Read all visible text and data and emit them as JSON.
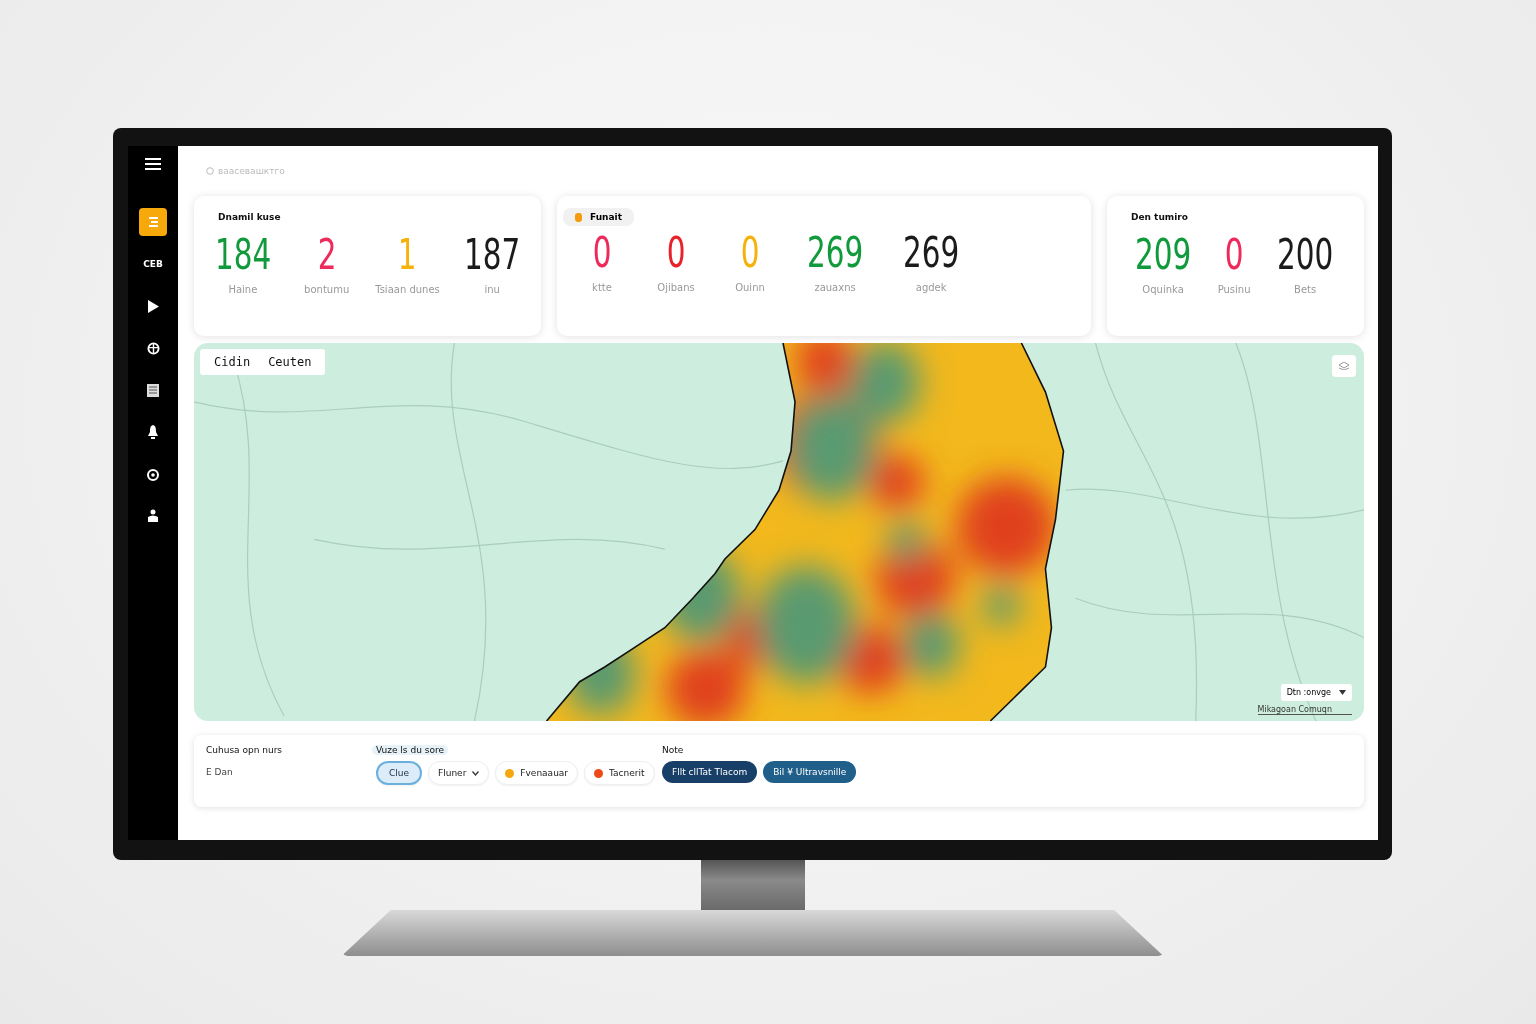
{
  "header": {
    "breadcrumb": "ваасевашктго"
  },
  "sidebar": {
    "items": [
      {
        "kind": "icon",
        "selected": true
      },
      {
        "kind": "text",
        "label": "CEB",
        "selected": false
      },
      {
        "kind": "icon",
        "selected": false
      },
      {
        "kind": "icon",
        "selected": false
      },
      {
        "kind": "icon",
        "selected": false
      },
      {
        "kind": "icon",
        "selected": false
      },
      {
        "kind": "icon",
        "selected": false
      },
      {
        "kind": "icon",
        "selected": false
      }
    ]
  },
  "cards": [
    {
      "kind": "plain",
      "title": "Dnamil kuse",
      "stats": [
        {
          "value": "184",
          "label": "Haine",
          "color": "#119a3c"
        },
        {
          "value": "2",
          "label": "bontumu",
          "color": "#ee2a5c"
        },
        {
          "value": "1",
          "label": "Tsiaan dunes",
          "color": "#f5b20c"
        },
        {
          "value": "187",
          "label": "inu",
          "color": "#1b1b1b"
        }
      ]
    },
    {
      "kind": "badge",
      "title": "Funait",
      "color": "#f59b0c",
      "stats": [
        {
          "value": "0",
          "label": "ktte",
          "color": "#ee2a5c"
        },
        {
          "value": "0",
          "label": "Ojibans",
          "color": "#e8222a"
        },
        {
          "value": "0",
          "label": "Ouinn",
          "color": "#f5b20c"
        },
        {
          "value": "269",
          "label": "zauaxns",
          "color": "#119a3c"
        },
        {
          "value": "269",
          "label": "agdek",
          "color": "#1b1b1b"
        }
      ]
    },
    {
      "kind": "plain",
      "title": "Den tumiro",
      "stats": [
        {
          "value": "209",
          "label": "Oquinka",
          "color": "#119a3c"
        },
        {
          "value": "0",
          "label": "Pusinu",
          "color": "#ee2a5c"
        },
        {
          "value": "200",
          "label": "Bets",
          "color": "#1b1b1b"
        }
      ]
    }
  ],
  "map": {
    "tabs": [
      "Cidin",
      "Ceuten"
    ],
    "dropdown": "Dtn :onvge",
    "attribution": "Mikagoan Comuqn"
  },
  "filters": {
    "sections": [
      {
        "label": "Cuhusa opn nurs",
        "value": "E Dan"
      },
      {
        "label": "Vuze ls du sore"
      },
      {
        "label": "Note"
      }
    ],
    "chips": [
      {
        "kind": "toggle",
        "label": "Clue",
        "selected": true
      },
      {
        "kind": "dropdown",
        "label": "Fluner"
      },
      {
        "kind": "dot",
        "label": "Fvenaauar",
        "color": "#f5a70c"
      },
      {
        "kind": "dot",
        "label": "Tacnerit",
        "color": "#ee4a18"
      }
    ],
    "buttons": [
      "Fllt cllTat Tlacom",
      "Bil ¥ Ultravsnille"
    ]
  }
}
